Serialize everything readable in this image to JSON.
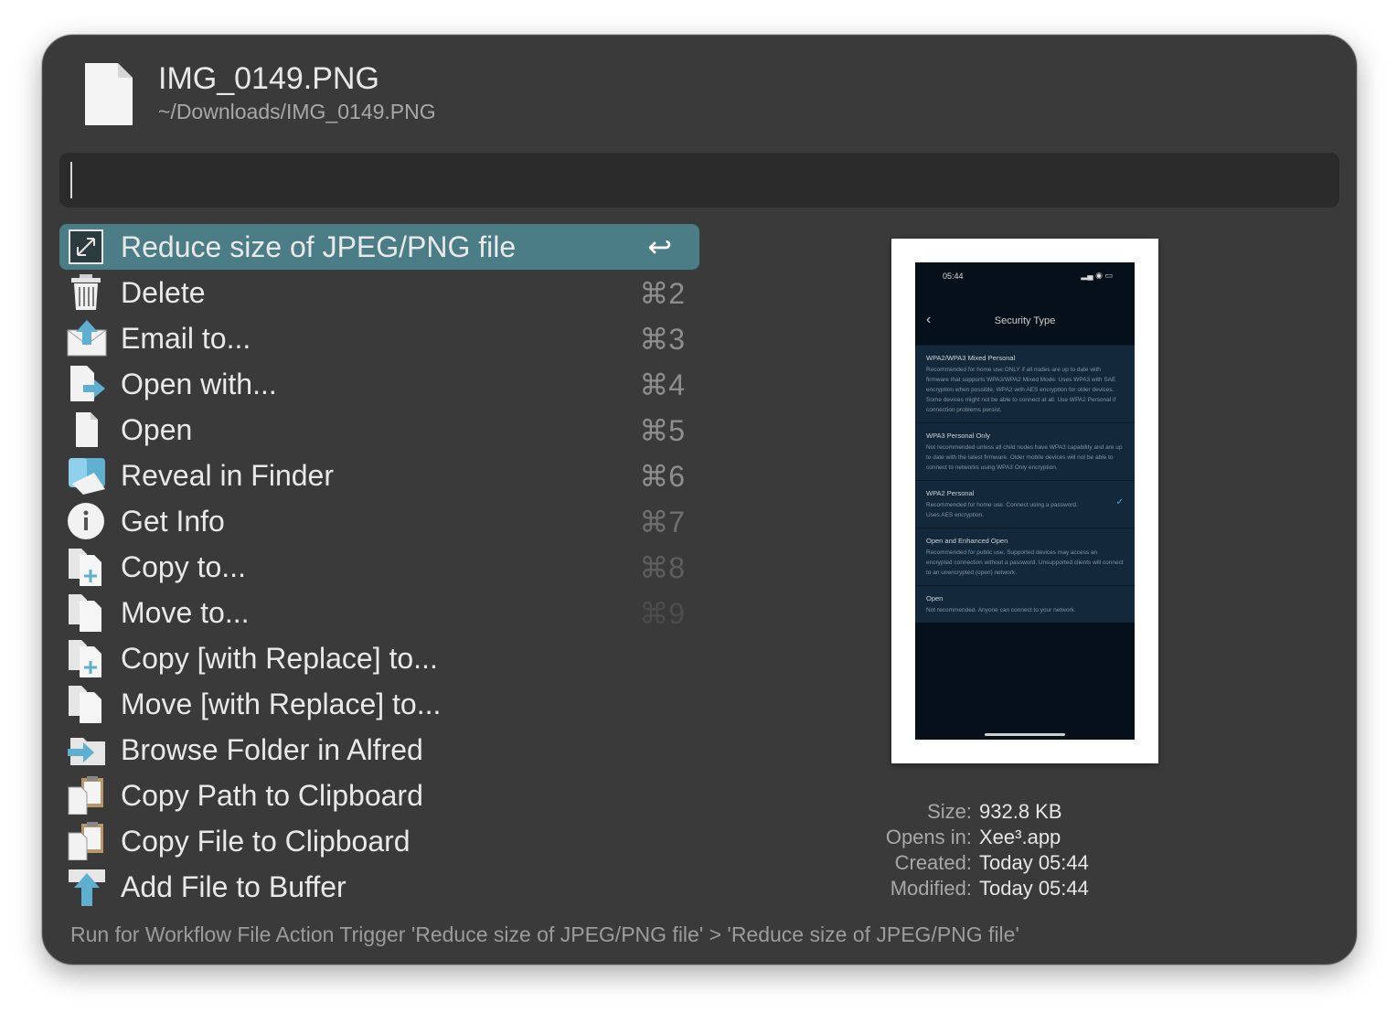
{
  "header": {
    "title": "IMG_0149.PNG",
    "path": "~/Downloads/IMG_0149.PNG"
  },
  "search": {
    "value": ""
  },
  "actions": [
    {
      "label": "Reduce size of JPEG/PNG file",
      "shortcut": "↩",
      "icon": "reduce-icon",
      "selected": true
    },
    {
      "label": "Delete",
      "shortcut": "⌘2",
      "icon": "trash-icon"
    },
    {
      "label": "Email to...",
      "shortcut": "⌘3",
      "icon": "email-icon"
    },
    {
      "label": "Open with...",
      "shortcut": "⌘4",
      "icon": "open-with-icon"
    },
    {
      "label": "Open",
      "shortcut": "⌘5",
      "icon": "document-icon"
    },
    {
      "label": "Reveal in Finder",
      "shortcut": "⌘6",
      "icon": "finder-icon"
    },
    {
      "label": "Get Info",
      "shortcut": "⌘7",
      "icon": "info-icon"
    },
    {
      "label": "Copy to...",
      "shortcut": "⌘8",
      "icon": "copy-to-icon"
    },
    {
      "label": "Move to...",
      "shortcut": "⌘9",
      "icon": "move-to-icon"
    },
    {
      "label": "Copy [with Replace] to...",
      "shortcut": "",
      "icon": "copy-replace-icon"
    },
    {
      "label": "Move [with Replace] to...",
      "shortcut": "",
      "icon": "move-replace-icon"
    },
    {
      "label": "Browse Folder in Alfred",
      "shortcut": "",
      "icon": "browse-folder-icon"
    },
    {
      "label": "Copy Path to Clipboard",
      "shortcut": "",
      "icon": "clipboard-path-icon"
    },
    {
      "label": "Copy File to Clipboard",
      "shortcut": "",
      "icon": "clipboard-file-icon"
    },
    {
      "label": "Add File to Buffer",
      "shortcut": "",
      "icon": "buffer-icon"
    }
  ],
  "preview": {
    "status_time": "05:44",
    "screen_title": "Security Type",
    "options": [
      {
        "title": "WPA2/WPA3 Mixed Personal",
        "desc": "Recommended for home use ONLY if all nodes are up to date with firmware that supports WPA3/WPA2 Mixed Mode. Uses WPA3 with SAE encryption when possible, WPA2 with AES encryption for older devices. Some devices might not be able to connect at all. Use WPA2 Personal if connection problems persist.",
        "checked": false
      },
      {
        "title": "WPA3 Personal Only",
        "desc": "Not recommended unless all child nodes have WPA3 capability and are up to date with the latest firmware. Older mobile devices will not be able to connect to networks using WPA3 Only encryption.",
        "checked": false
      },
      {
        "title": "WPA2 Personal",
        "desc": "Recommended for home use. Connect using a password. Uses AES encryption.",
        "checked": true
      },
      {
        "title": "Open and Enhanced Open",
        "desc": "Recommended for public use. Supported devices may access an encrypted connection without a password. Unsupported clients will connect to an unencrypted (open) network.",
        "checked": false
      },
      {
        "title": "Open",
        "desc": "Not recommended. Anyone can connect to your network.",
        "checked": false
      }
    ]
  },
  "meta": [
    {
      "key": "Size:",
      "value": "932.8 KB"
    },
    {
      "key": "Opens in:",
      "value": "Xee³.app"
    },
    {
      "key": "Created:",
      "value": "Today 05:44"
    },
    {
      "key": "Modified:",
      "value": "Today 05:44"
    }
  ],
  "footer": "Run for Workflow File Action Trigger 'Reduce size of JPEG/PNG file' > 'Reduce size of JPEG/PNG file'",
  "colors": {
    "window_bg": "#3a3a3a",
    "selected_row": "#4b7d87",
    "accent_blue": "#5fb0d0"
  }
}
